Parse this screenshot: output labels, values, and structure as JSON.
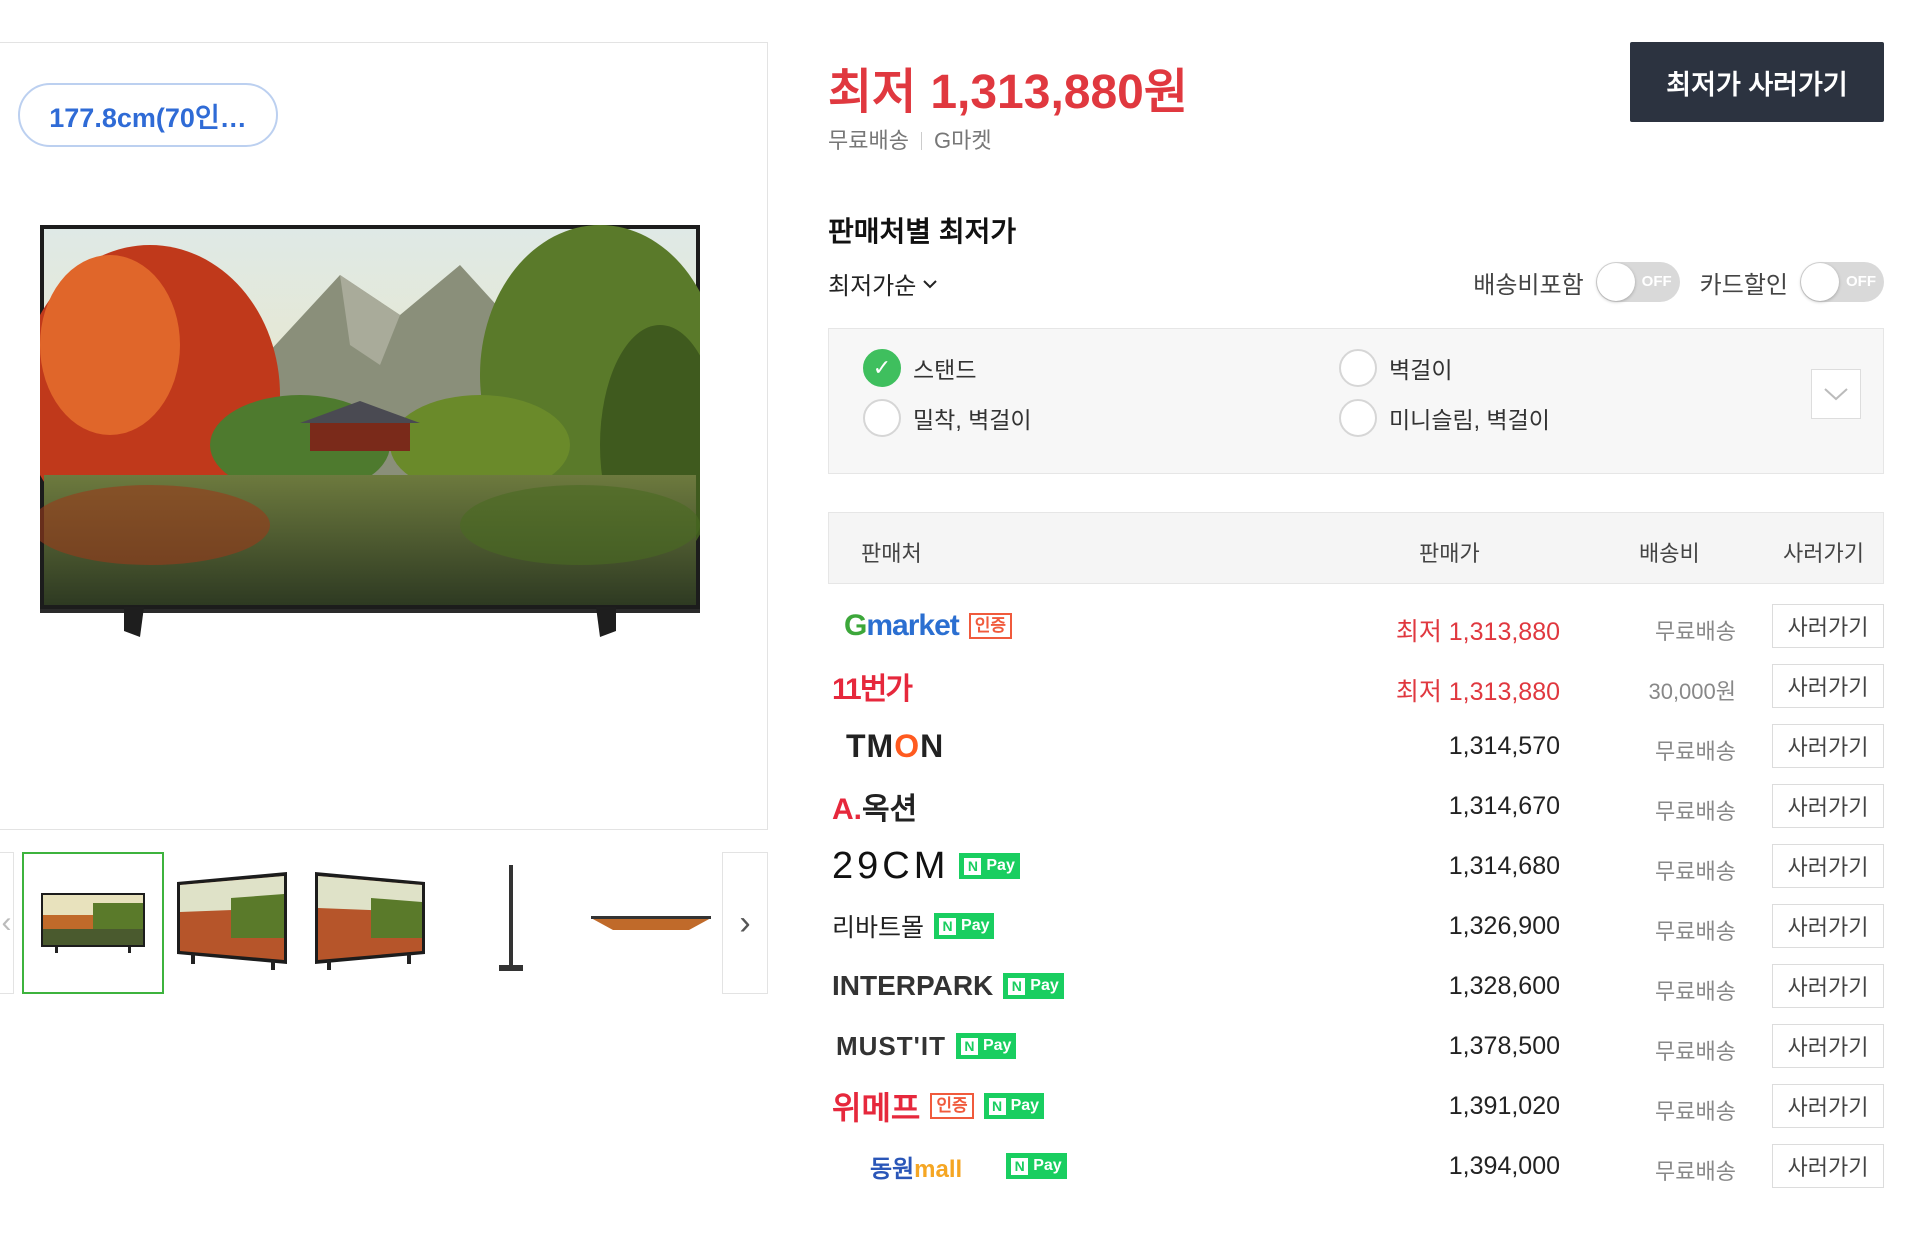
{
  "product": {
    "size_chip": "177.8cm(70인…"
  },
  "gallery": {
    "prev_icon": "chevron-left-icon",
    "next_icon": "chevron-right-icon",
    "thumbs": [
      "front-view",
      "angle-left-view",
      "angle-right-view",
      "side-view",
      "top-view"
    ]
  },
  "price": {
    "label": "최저",
    "value": "1,313,880원",
    "shipping": "무료배송",
    "seller": "G마켓",
    "buy_button": "최저가 사러가기"
  },
  "compare": {
    "title": "판매처별 최저가",
    "sort_label": "최저가순",
    "toggle_shipping_label": "배송비포함",
    "toggle_card_label": "카드할인",
    "toggle_off": "OFF",
    "options": [
      "스탠드",
      "벽걸이",
      "밀착, 벽걸이",
      "미니슬림, 벽걸이"
    ],
    "selected_option": "스탠드"
  },
  "table": {
    "headers": {
      "seller": "판매처",
      "price": "판매가",
      "shipping": "배송비",
      "buy": "사러가기"
    },
    "low_label": "최저",
    "rows": [
      {
        "seller": "Gmarket",
        "badges": [
          "인증"
        ],
        "price": "1,313,880",
        "lowest": true,
        "shipping": "무료배송",
        "buy": "사러가기"
      },
      {
        "seller": "11번가",
        "badges": [],
        "price": "1,313,880",
        "lowest": true,
        "shipping": "30,000원",
        "buy": "사러가기"
      },
      {
        "seller": "TMON",
        "badges": [],
        "price": "1,314,570",
        "lowest": false,
        "shipping": "무료배송",
        "buy": "사러가기"
      },
      {
        "seller": "A.옥션",
        "badges": [],
        "price": "1,314,670",
        "lowest": false,
        "shipping": "무료배송",
        "buy": "사러가기"
      },
      {
        "seller": "29CM",
        "badges": [
          "N Pay"
        ],
        "price": "1,314,680",
        "lowest": false,
        "shipping": "무료배송",
        "buy": "사러가기"
      },
      {
        "seller": "리바트몰",
        "badges": [
          "N Pay"
        ],
        "price": "1,326,900",
        "lowest": false,
        "shipping": "무료배송",
        "buy": "사러가기"
      },
      {
        "seller": "INTERPARK",
        "badges": [
          "N Pay"
        ],
        "price": "1,328,600",
        "lowest": false,
        "shipping": "무료배송",
        "buy": "사러가기"
      },
      {
        "seller": "MUST'IT",
        "badges": [
          "N Pay"
        ],
        "price": "1,378,500",
        "lowest": false,
        "shipping": "무료배송",
        "buy": "사러가기"
      },
      {
        "seller": "위메프",
        "badges": [
          "인증",
          "N Pay"
        ],
        "price": "1,391,020",
        "lowest": false,
        "shipping": "무료배송",
        "buy": "사러가기"
      },
      {
        "seller": "동원mall",
        "badges": [
          "N Pay"
        ],
        "price": "1,394,000",
        "lowest": false,
        "shipping": "무료배송",
        "buy": "사러가기"
      }
    ]
  },
  "badge_text": {
    "cert": "인증",
    "npay_n": "N",
    "npay_pay": "Pay"
  },
  "colors": {
    "accent_red": "#e0383f",
    "dark_button": "#2c3340",
    "check_green": "#3fbf5e",
    "npay_green": "#19ce60",
    "chip_blue": "#2f6bd6"
  }
}
